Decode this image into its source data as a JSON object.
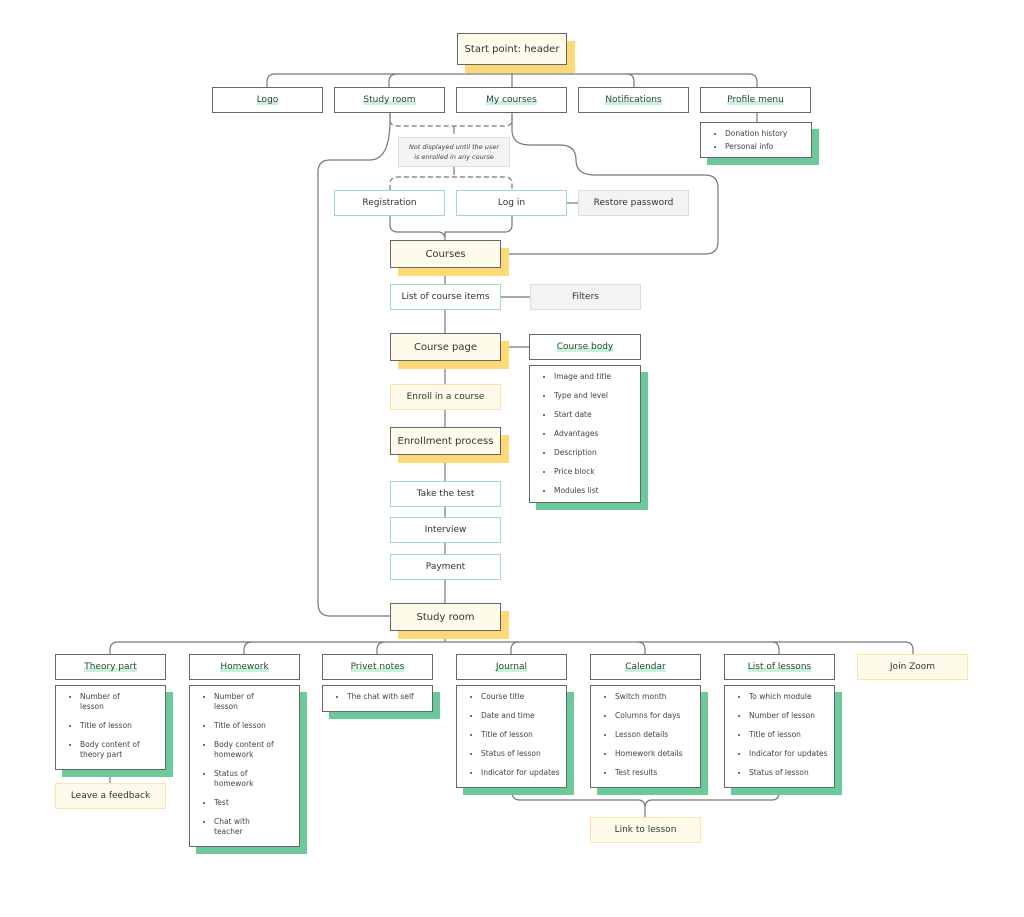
{
  "start": "Start point: header",
  "header_items": [
    "Logo",
    "Study room",
    "My courses",
    "Notifications",
    "Profile menu"
  ],
  "profile_list": [
    "Donation history",
    "Personal info"
  ],
  "note": "Not displayed until the user is enrolled in any course",
  "auth": {
    "registration": "Registration",
    "login": "Log in",
    "restore": "Restore password"
  },
  "courses": "Courses",
  "list_items": "List of course items",
  "filters": "Filters",
  "course_page": "Course page",
  "course_body": {
    "title": "Course body",
    "items": [
      "Image and title",
      "Type and level",
      "Start date",
      "Advantages",
      "Description",
      "Price block",
      "Modules list"
    ]
  },
  "enroll": "Enroll in a course",
  "enrollment_process": "Enrollment process",
  "steps": [
    "Take the test",
    "Interview",
    "Payment"
  ],
  "study_room": "Study room",
  "sections": [
    {
      "title": "Theory part",
      "items": [
        "Number of lesson",
        "Title of lesson",
        "Body content of theory part"
      ]
    },
    {
      "title": "Homework",
      "items": [
        "Number of lesson",
        "Title of lesson",
        "Body content of homework",
        "Status of homework",
        "Test",
        "Chat with teacher"
      ]
    },
    {
      "title": "Privet notes",
      "items": [
        "The chat with self"
      ]
    },
    {
      "title": "Journal",
      "items": [
        "Course title",
        "Date and time",
        "Title of lesson",
        "Status of lesson",
        "Indicator for updates"
      ]
    },
    {
      "title": "Calendar",
      "items": [
        "Switch month",
        "Columns for days",
        "Lesson details",
        "Homework details",
        "Test results"
      ]
    },
    {
      "title": "List of lessons",
      "items": [
        "To which module",
        "Number of lesson",
        "Title of lesson",
        "Indicator for updates",
        "Status of lesson"
      ]
    }
  ],
  "join_zoom": "Join Zoom",
  "leave_feedback": "Leave a feedback",
  "link_to_lesson": "Link to lesson",
  "colors": {
    "yellow_shadow": "#fdd977",
    "green_shadow": "#6cc99a",
    "light_yellow": "#fffbea",
    "gray": "#f3f3f3"
  }
}
